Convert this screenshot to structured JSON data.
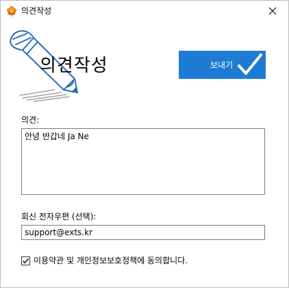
{
  "window": {
    "title": "의견작성",
    "icon": "flower-icon",
    "close_icon": "close-icon"
  },
  "header": {
    "heading": "의견작성",
    "illustration": "pencil-icon",
    "send_label": "보내기",
    "send_icon": "checkmark-icon",
    "accent_color": "#1e7bd4"
  },
  "form": {
    "opinion_label": "의견:",
    "opinion_value": "안녕 반갑네 Ja Ne",
    "email_label": "회신 전자우편 (선택):",
    "email_value": "support@exts.kr",
    "agree_checked": true,
    "agree_label": "이용약관 및 개인정보보호정책에 동의합니다."
  }
}
